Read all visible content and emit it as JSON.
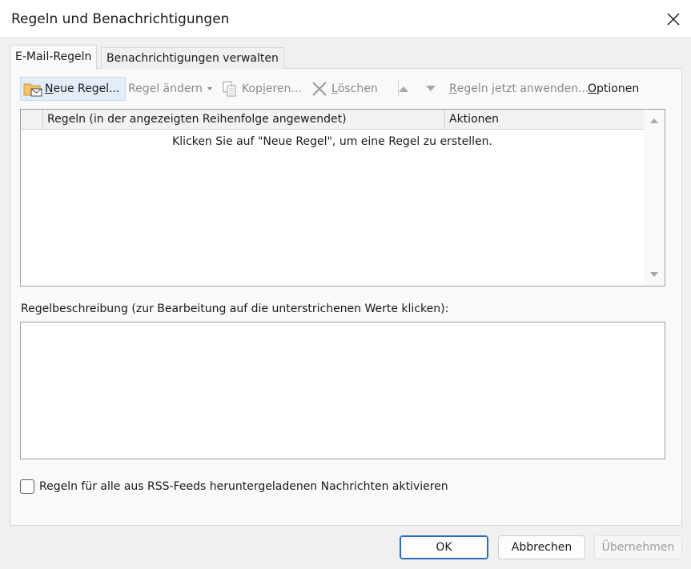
{
  "window": {
    "title": "Regeln und Benachrichtigungen"
  },
  "tabs": [
    {
      "label": "E-Mail-Regeln",
      "active": true
    },
    {
      "label": "Benachrichtigungen verwalten",
      "active": false
    }
  ],
  "toolbar": {
    "new_rule": {
      "u": "N",
      "rest": "eue Regel..."
    },
    "change_rule": "Regel ändern",
    "copy": {
      "pre": "Kop",
      "u": "i",
      "rest": "eren..."
    },
    "delete": {
      "u": "L",
      "rest": "öschen"
    },
    "apply_now": {
      "u": "R",
      "rest": "egeln jetzt anwenden..."
    },
    "options": {
      "u": "O",
      "rest": "ptionen"
    }
  },
  "rules_list": {
    "columns": [
      "Regeln (in der angezeigten Reihenfolge angewendet)",
      "Aktionen"
    ],
    "empty_message": "Klicken Sie auf \"Neue Regel\", um eine Regel zu erstellen."
  },
  "description": {
    "label": "Regelbeschreibung (zur Bearbeitung auf die unterstrichenen Werte klicken):"
  },
  "rss_checkbox": {
    "label": "Regeln für alle aus RSS-Feeds heruntergeladenen Nachrichten aktivieren",
    "checked": false
  },
  "buttons": {
    "ok": "OK",
    "cancel": "Abbrechen",
    "apply": "Übernehmen"
  },
  "colors": {
    "accent": "#2a6bbf",
    "hover_bg": "#e3edf8",
    "disabled_text": "#8a8a8a"
  }
}
